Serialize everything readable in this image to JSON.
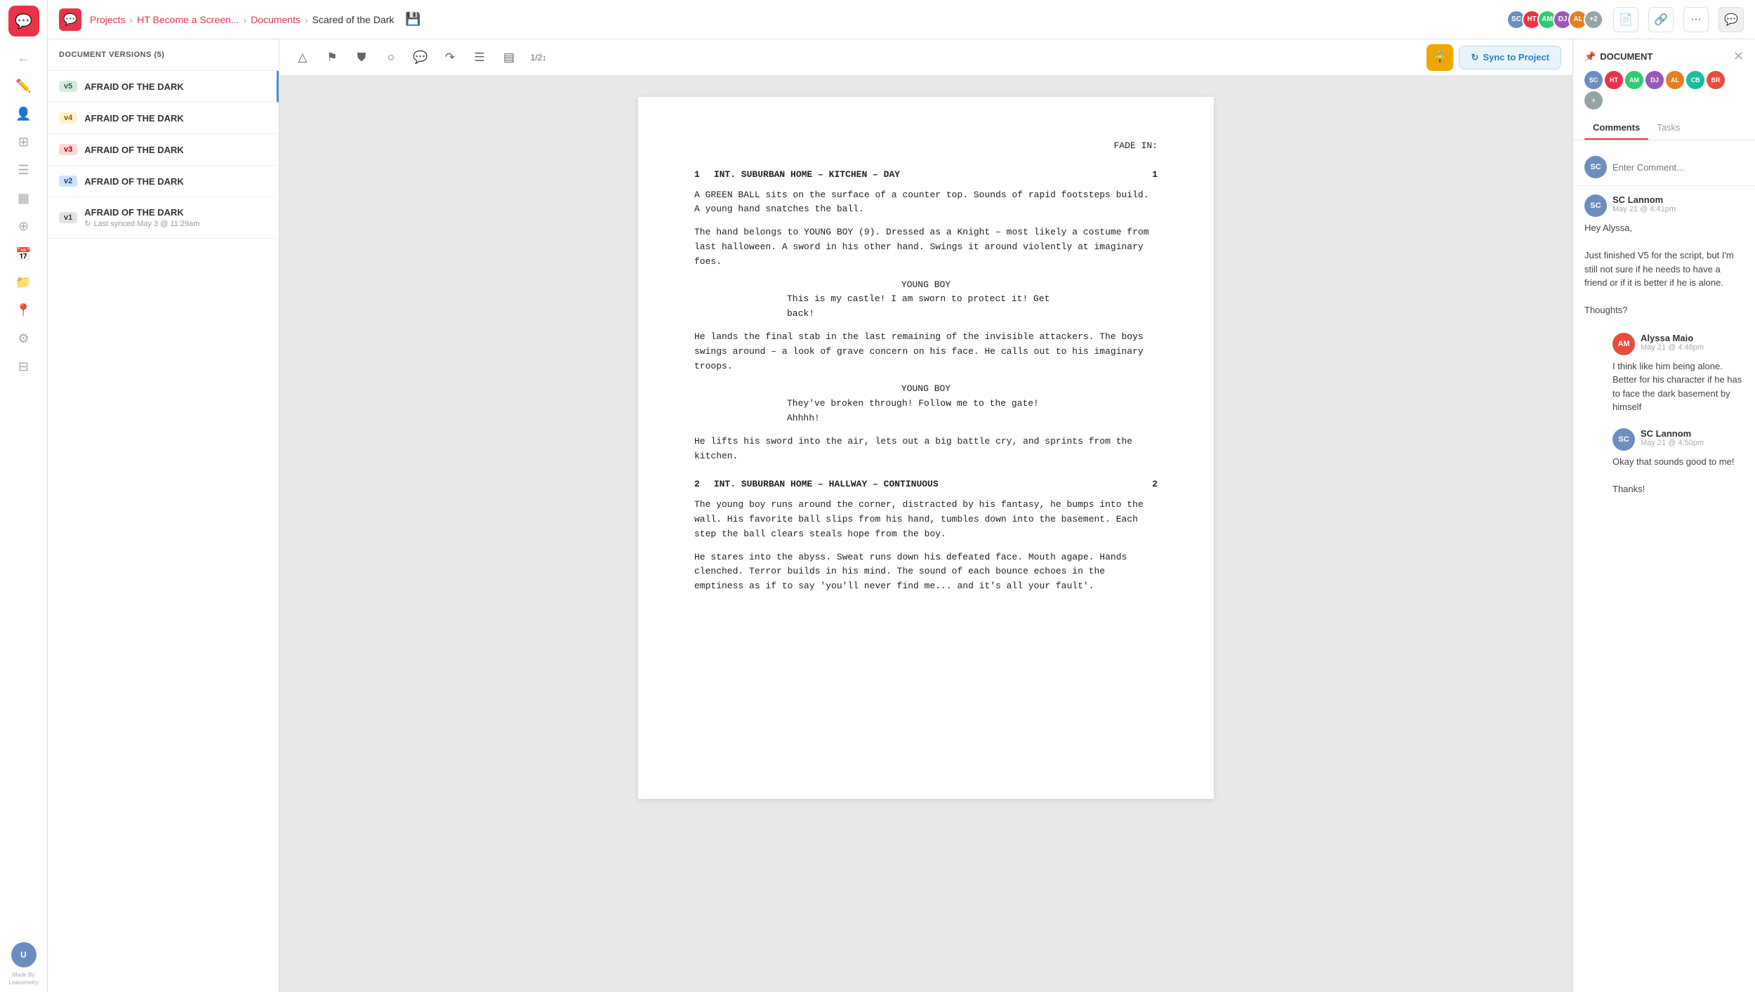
{
  "app": {
    "logo_icon": "💬",
    "made_by": "Made By\nLeanometry"
  },
  "nav": {
    "breadcrumb": {
      "projects": "Projects",
      "project": "HT Become a Screen...",
      "documents": "Documents",
      "current": "Scared of the Dark"
    },
    "save_icon": "💾",
    "buttons": [
      "📄",
      "🔗",
      "···",
      "💬"
    ]
  },
  "left_sidebar": {
    "icons": [
      {
        "name": "back-icon",
        "symbol": "←"
      },
      {
        "name": "edit-icon",
        "symbol": "✏️"
      },
      {
        "name": "users-icon",
        "symbol": "👤"
      },
      {
        "name": "dashboard-icon",
        "symbol": "⊞"
      },
      {
        "name": "list-icon",
        "symbol": "☰"
      },
      {
        "name": "table-icon",
        "symbol": "▦"
      },
      {
        "name": "app-icon",
        "symbol": "⊕"
      },
      {
        "name": "calendar-icon",
        "symbol": "📅"
      },
      {
        "name": "folder-icon",
        "symbol": "📁"
      },
      {
        "name": "location-icon",
        "symbol": "📍"
      },
      {
        "name": "filter-icon",
        "symbol": "⚙"
      },
      {
        "name": "grid-icon",
        "symbol": "⊟"
      }
    ],
    "avatar": "U"
  },
  "versions_panel": {
    "header": "DOCUMENT VERSIONS (5)",
    "versions": [
      {
        "badge": "v5",
        "badge_class": "badge-v5",
        "name": "AFRAID OF THE DARK",
        "sync": null,
        "active": true
      },
      {
        "badge": "v4",
        "badge_class": "badge-v4",
        "name": "AFRAID OF THE DARK",
        "sync": null,
        "active": false
      },
      {
        "badge": "v3",
        "badge_class": "badge-v3",
        "name": "AFRAID OF THE DARK",
        "sync": null,
        "active": false
      },
      {
        "badge": "v2",
        "badge_class": "badge-v2",
        "name": "AFRAID OF THE DARK",
        "sync": null,
        "active": false
      },
      {
        "badge": "v1",
        "badge_class": "badge-v1",
        "name": "AFRAID OF THE DARK",
        "sync": "Last synced May 3 @ 11:29am",
        "active": false
      }
    ]
  },
  "toolbar": {
    "icons": [
      {
        "name": "mountain-icon",
        "symbol": "△"
      },
      {
        "name": "flag-icon",
        "symbol": "⚑"
      },
      {
        "name": "shield-icon",
        "symbol": "⛉"
      },
      {
        "name": "circle-icon",
        "symbol": "○"
      },
      {
        "name": "comment-icon",
        "symbol": "💬"
      },
      {
        "name": "forward-icon",
        "symbol": "↷"
      },
      {
        "name": "justify-icon",
        "symbol": "☰"
      },
      {
        "name": "align-icon",
        "symbol": "▤"
      },
      {
        "name": "numbering-icon",
        "symbol": "1/2"
      }
    ],
    "lock_icon": "🔒",
    "sync_btn": "Sync to Project"
  },
  "document": {
    "fade_in": "FADE IN:",
    "scene1": {
      "num": "1",
      "heading": "INT. SUBURBAN HOME – KITCHEN – DAY",
      "num_right": "1",
      "paragraphs": [
        "A GREEN BALL sits on the surface of a counter top. Sounds of rapid footsteps build. A young hand snatches the ball.",
        "The hand belongs to YOUNG BOY (9). Dressed as a Knight – most likely a costume from last halloween. A sword in his other hand. Swings it around violently at imaginary foes.",
        "He lands the final stab in the last remaining of the invisible attackers. The boys swings around – a look of grave concern on his face. He calls out to his imaginary troops.",
        "He lifts his sword into the air, lets out a big battle cry, and sprints from the kitchen."
      ],
      "dialog1": {
        "character": "YOUNG BOY",
        "lines": "This is my castle! I am sworn to protect it! Get back!"
      },
      "dialog2": {
        "character": "YOUNG BOY",
        "lines": "They've broken through! Follow me to the gate! Ahhhh!"
      }
    },
    "scene2": {
      "num": "2",
      "heading": "INT. SUBURBAN HOME – HALLWAY – CONTINUOUS",
      "num_right": "2",
      "paragraphs": [
        "The young boy runs around the corner, distracted by his fantasy, he bumps into the wall. His favorite ball slips from his hand, tumbles down into the basement. Each step the ball clears steals hope from the boy.",
        "He stares into the abyss. Sweat runs down his defeated face. Mouth agape. Hands clenched. Terror builds in his mind. The sound of each bounce echoes in the emptiness as if to say 'you'll never find me... and it's all your fault'."
      ]
    }
  },
  "right_panel": {
    "title": "DOCUMENT",
    "pin_icon": "📌",
    "avatars": [
      {
        "initials": "SC",
        "color": "#6c8ebf"
      },
      {
        "initials": "HT",
        "color": "#e8334a"
      },
      {
        "initials": "AM",
        "color": "#2ecc71"
      },
      {
        "initials": "DJ",
        "color": "#9b59b6"
      },
      {
        "initials": "AL",
        "color": "#e67e22"
      },
      {
        "initials": "CB",
        "color": "#1abc9c"
      },
      {
        "initials": "BR",
        "color": "#e74c3c"
      },
      {
        "initials": "+",
        "color": "#95a5a6"
      }
    ],
    "tabs": [
      "Comments",
      "Tasks"
    ],
    "active_tab": "Comments",
    "comment_placeholder": "Enter Comment...",
    "comment_user_color": "#6c8ebf",
    "comment_user_initials": "SC",
    "comments": [
      {
        "id": "c1",
        "author": "SC Lannom",
        "avatar_color": "#6c8ebf",
        "avatar_initials": "SC",
        "time": "May 21 @ 4:41pm",
        "text": "Hey Alyssa,\n\nJust finished V5 for the script, but I'm still not sure if he needs to have a friend or if it is better if he is alone.\n\nThoughts?"
      },
      {
        "id": "c2",
        "author": "Alyssa Maio",
        "avatar_color": "#e74c3c",
        "avatar_initials": "AM",
        "time": "May 21 @ 4:48pm",
        "text": "I think like him being alone. Better for his character if he has to face the dark basement by himself",
        "is_reply": true
      },
      {
        "id": "c3",
        "author": "SC Lannom",
        "avatar_color": "#6c8ebf",
        "avatar_initials": "SC",
        "time": "May 21 @ 4:50pm",
        "text": "Okay that sounds good to me!\n\nThanks!",
        "is_reply": true
      }
    ]
  }
}
